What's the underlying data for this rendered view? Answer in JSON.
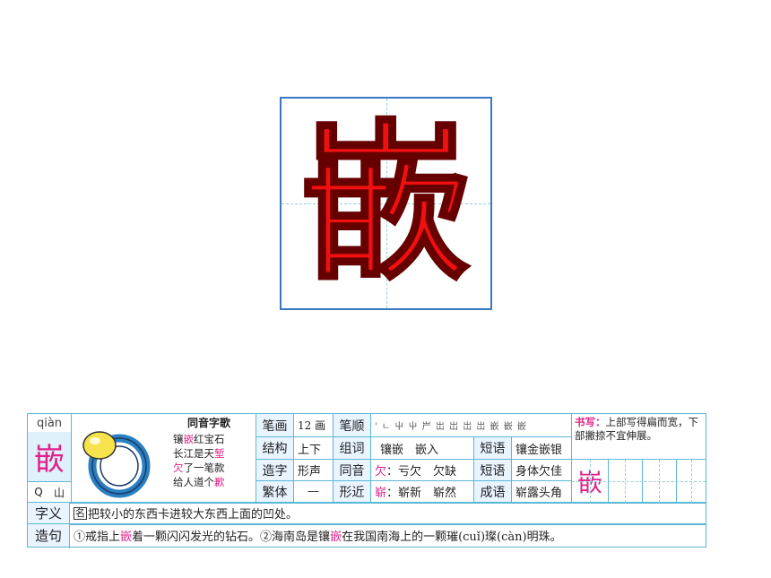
{
  "character": "嵌",
  "pinyin": "qiàn",
  "radical_index": {
    "letter": "Q",
    "radical": "山"
  },
  "homophone_song": {
    "title": "同音字歌",
    "lines": [
      {
        "pre": "镶",
        "hl": "嵌",
        "post": "红宝石"
      },
      {
        "pre": "长江是天",
        "hl": "堑",
        "post": ""
      },
      {
        "pre": "",
        "hl": "欠",
        "post": "了一笔款"
      },
      {
        "pre": "给人道个",
        "hl": "歉",
        "post": ""
      }
    ]
  },
  "strokes": {
    "label": "笔画",
    "value": "12 画"
  },
  "stroke_order": {
    "label": "笔顺",
    "value": "' ㄴ 屮 屮 屵 岀 岀 岀 岀 嵌 嵌 嵌"
  },
  "structure": {
    "label": "结构",
    "value": "上下"
  },
  "words": {
    "label": "组词",
    "value": "镶嵌　嵌入"
  },
  "phrase1": {
    "label": "短语",
    "value": "镶金嵌银"
  },
  "formation": {
    "label": "造字",
    "value": "形声"
  },
  "homophones": {
    "label": "同音",
    "key": "欠",
    "value": "：亏欠　欠缺"
  },
  "phrase2": {
    "label": "短语",
    "value": "身体欠佳"
  },
  "traditional": {
    "label": "繁体",
    "value": "—"
  },
  "similar": {
    "label": "形近",
    "key": "崭",
    "value": "：崭新　崭然"
  },
  "idiom": {
    "label": "成语",
    "value": "崭露头角"
  },
  "writing_tip": {
    "label": "书写：",
    "text": "上部写得扁而宽，下部撇捺不宜伸展。"
  },
  "meaning": {
    "label": "字义",
    "tag": "名",
    "text": "把较小的东西卡进较大东西上面的凹处。"
  },
  "sentences": {
    "label": "造句",
    "s1_pre": "①戒指上",
    "s1_hl": "嵌",
    "s1_post": "着一颗闪闪发光的钻石。",
    "s2_pre": "②海南岛是镶",
    "s2_hl": "嵌",
    "s2_post": "在我国南海上的一颗璀(cuǐ)璨(càn)明珠。"
  }
}
